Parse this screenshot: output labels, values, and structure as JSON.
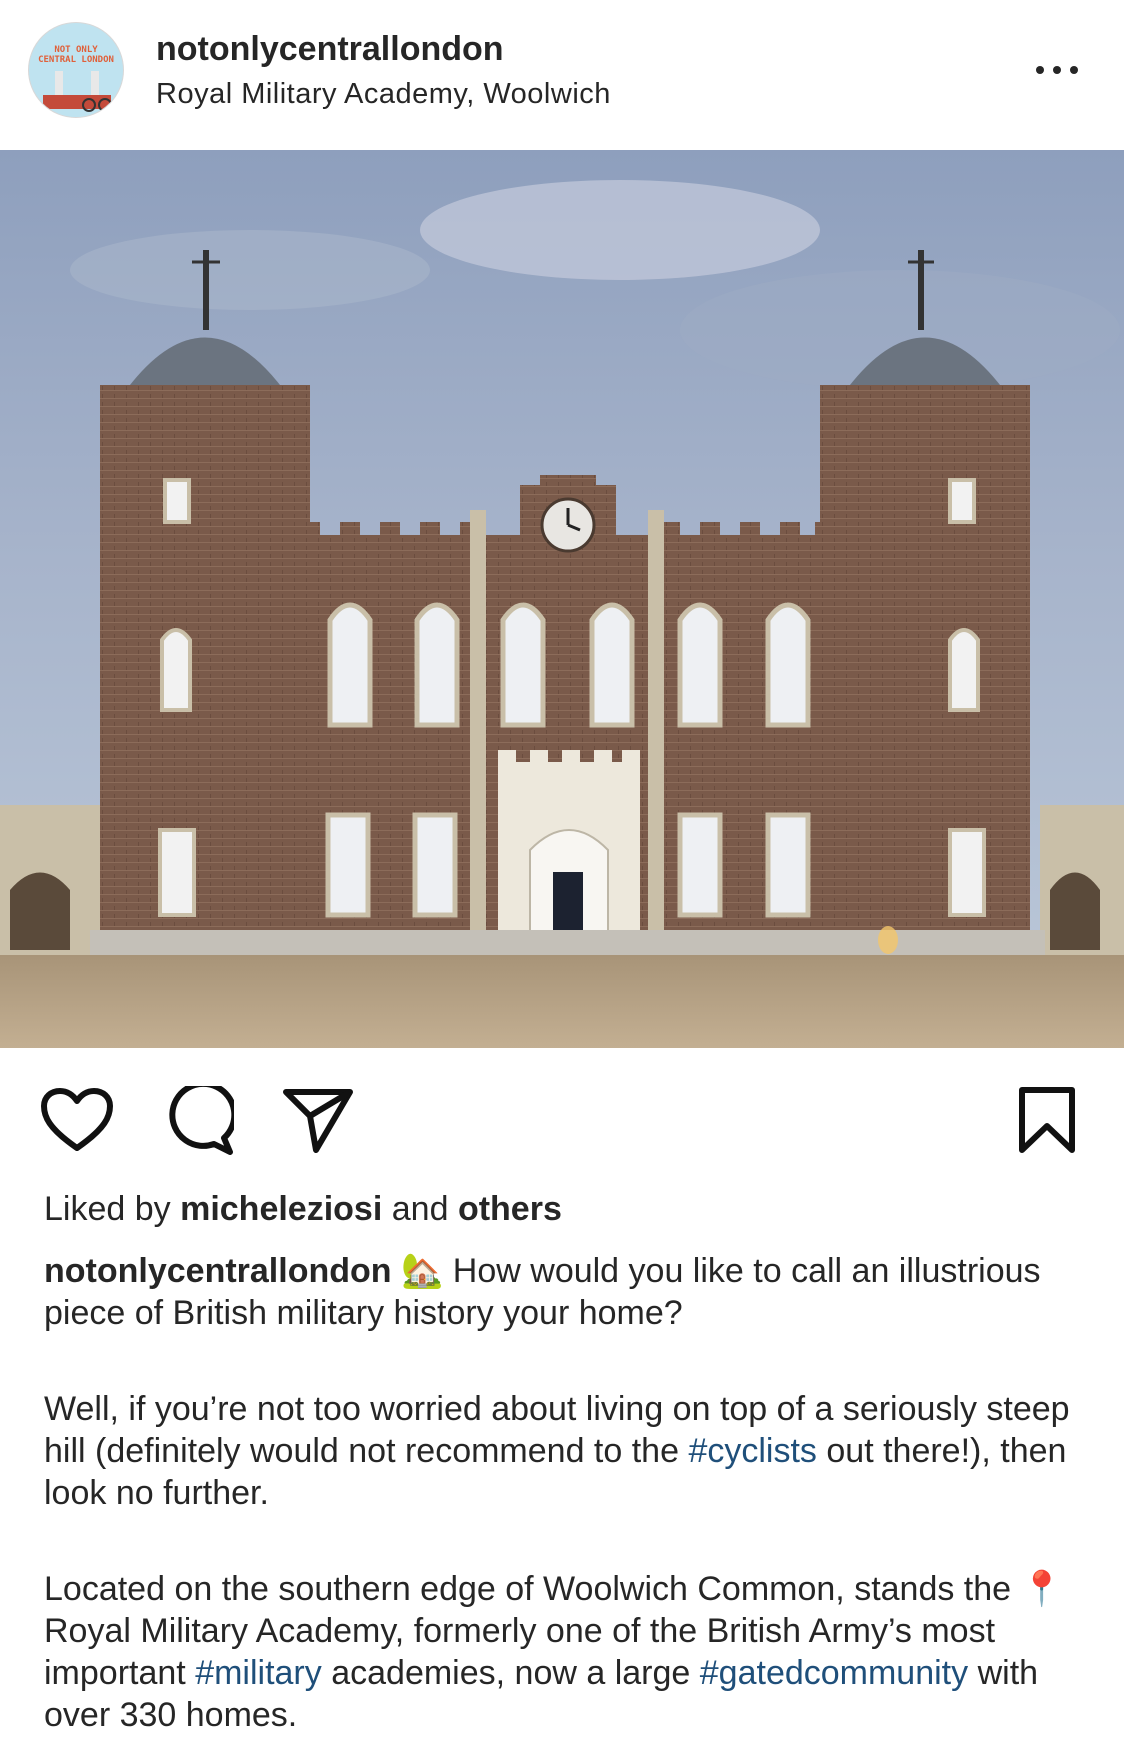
{
  "post": {
    "username": "notonlycentrallondon",
    "location": "Royal Military Academy, Woolwich",
    "avatar_text_line1": "NOT ONLY",
    "avatar_text_line2": "CENTRAL LONDON"
  },
  "image": {
    "subject": "Royal Military Academy, Woolwich",
    "colors": {
      "sky_top": "#8e9fbd",
      "sky_bottom": "#b9c6d8",
      "brick": "#7a5a4a",
      "stone": "#c9c1ad",
      "ground": "#b8a488"
    }
  },
  "actions": {
    "like_icon": "heart-icon",
    "comment_icon": "comment-icon",
    "share_icon": "send-icon",
    "save_icon": "bookmark-icon"
  },
  "likes": {
    "prefix": "Liked by",
    "user": "micheleziosi",
    "joiner": "and",
    "others": "others"
  },
  "caption": {
    "username": "notonlycentrallondon",
    "emoji": "🏡",
    "p1_text": "How would you like to call an illustrious piece of British military history your home?",
    "p2_before": "Well, if you’re not too worried about living on top of a seriously steep hill (definitely would not recommend to the",
    "p2_tag": "#cyclists",
    "p2_after": "out there!), then look no further.",
    "p3_before": "Located on the southern edge of Woolwich Common, stands the",
    "p3_pin": "📍",
    "p3_mid": "Royal Military Academy, formerly one of the British Army’s most important",
    "p3_tag1": "#military",
    "p3_mid2": "academies, now a large",
    "p3_tag2": "#gatedcommunity",
    "p3_after": "with over 330 homes."
  }
}
